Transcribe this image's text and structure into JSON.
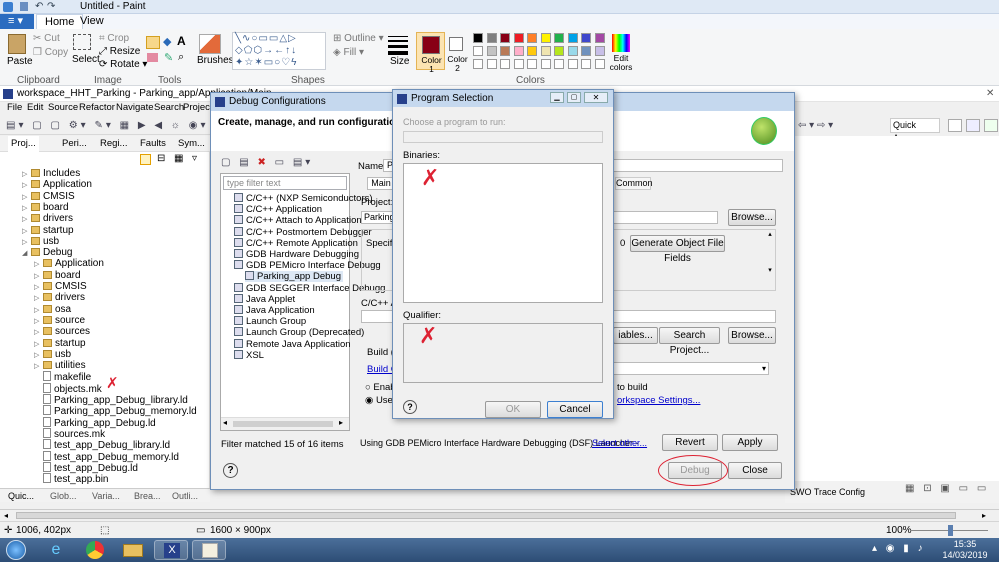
{
  "paint": {
    "title": "Untitled - Paint",
    "tabs": [
      "Home",
      "View"
    ],
    "groups": [
      "Clipboard",
      "Image",
      "Tools",
      "Shapes",
      "Colors"
    ],
    "clipboard": {
      "paste": "Paste",
      "cut": "Cut",
      "copy": "Copy"
    },
    "image": {
      "select": "Select",
      "crop": "Crop",
      "resize": "Resize",
      "rotate": "Rotate"
    },
    "brushes": "Brushes",
    "outline": "Outline",
    "fill": "Fill",
    "size": "Size",
    "color1": "Color 1",
    "color2": "Color 2",
    "edit_colors": "Edit colors",
    "palette": [
      "#000000",
      "#7f7f7f",
      "#880015",
      "#ed1c24",
      "#ff7f27",
      "#fff200",
      "#22b14c",
      "#00a2e8",
      "#3f48cc",
      "#a349a4",
      "#ffffff",
      "#c3c3c3",
      "#b97a57",
      "#ffaec9",
      "#ffc90e",
      "#efe4b0",
      "#b5e61d",
      "#99d9ea",
      "#7092be",
      "#c8bfe7"
    ],
    "status_pos": "1006, 402px",
    "status_size": "1600 × 900px",
    "zoom": "100%"
  },
  "eclipse": {
    "title": "workspace_HHT_Parking - Parking_app/Application/Main_",
    "menu": [
      "File",
      "Edit",
      "Source",
      "Refactor",
      "Navigate",
      "Search",
      "Project"
    ],
    "view_tabs": [
      "Proj...",
      "Peri...",
      "Regi...",
      "Faults",
      "Sym..."
    ],
    "tree": [
      {
        "label": "Includes",
        "type": "folder",
        "indent": 0
      },
      {
        "label": "Application",
        "type": "folder",
        "indent": 0
      },
      {
        "label": "CMSIS",
        "type": "folder",
        "indent": 0
      },
      {
        "label": "board",
        "type": "folder",
        "indent": 0
      },
      {
        "label": "drivers",
        "type": "folder",
        "indent": 0
      },
      {
        "label": "startup",
        "type": "folder",
        "indent": 0
      },
      {
        "label": "usb",
        "type": "folder",
        "indent": 0
      },
      {
        "label": "Debug",
        "type": "folder",
        "indent": 0
      },
      {
        "label": "Application",
        "type": "folder",
        "indent": 1
      },
      {
        "label": "board",
        "type": "folder",
        "indent": 1
      },
      {
        "label": "CMSIS",
        "type": "folder",
        "indent": 1
      },
      {
        "label": "drivers",
        "type": "folder",
        "indent": 1
      },
      {
        "label": "osa",
        "type": "folder",
        "indent": 1
      },
      {
        "label": "source",
        "type": "folder",
        "indent": 1
      },
      {
        "label": "sources",
        "type": "folder",
        "indent": 1
      },
      {
        "label": "startup",
        "type": "folder",
        "indent": 1
      },
      {
        "label": "usb",
        "type": "folder",
        "indent": 1
      },
      {
        "label": "utilities",
        "type": "folder",
        "indent": 1
      },
      {
        "label": "makefile",
        "type": "file",
        "indent": 1
      },
      {
        "label": "objects.mk",
        "type": "file",
        "indent": 1
      },
      {
        "label": "Parking_app_Debug_library.ld",
        "type": "file",
        "indent": 1
      },
      {
        "label": "Parking_app_Debug_memory.ld",
        "type": "file",
        "indent": 1
      },
      {
        "label": "Parking_app_Debug.ld",
        "type": "file",
        "indent": 1
      },
      {
        "label": "sources.mk",
        "type": "file",
        "indent": 1
      },
      {
        "label": "test_app_Debug_library.ld",
        "type": "file",
        "indent": 1
      },
      {
        "label": "test_app_Debug_memory.ld",
        "type": "file",
        "indent": 1
      },
      {
        "label": "test_app_Debug.ld",
        "type": "file",
        "indent": 1
      },
      {
        "label": "test_app.bin",
        "type": "file",
        "indent": 1
      }
    ],
    "bottom_tabs": [
      "Quic...",
      "Glob...",
      "Varia...",
      "Brea...",
      "Outli..."
    ],
    "quick_access": "Quick Access",
    "trace_config": "SWO Trace Config"
  },
  "debug_config": {
    "title": "Debug Configurations",
    "heading": "Create, manage, and run configurations",
    "filter_placeholder": "type filter text",
    "items": [
      {
        "label": "C/C++ (NXP Semiconductors)",
        "indent": 0
      },
      {
        "label": "C/C++ Application",
        "indent": 0
      },
      {
        "label": "C/C++ Attach to Application",
        "indent": 0
      },
      {
        "label": "C/C++ Postmortem Debugger",
        "indent": 0
      },
      {
        "label": "C/C++ Remote Application",
        "indent": 0
      },
      {
        "label": "GDB Hardware Debugging",
        "indent": 0
      },
      {
        "label": "GDB PEMicro Interface Debugg",
        "indent": 0
      },
      {
        "label": "Parking_app Debug",
        "indent": 1
      },
      {
        "label": "GDB SEGGER Interface Debugg",
        "indent": 0
      },
      {
        "label": "Java Applet",
        "indent": 0
      },
      {
        "label": "Java Application",
        "indent": 0
      },
      {
        "label": "Launch Group",
        "indent": 0
      },
      {
        "label": "Launch Group (Deprecated)",
        "indent": 0
      },
      {
        "label": "Remote Java Application",
        "indent": 0
      },
      {
        "label": "XSL",
        "indent": 0
      }
    ],
    "filter_status": "Filter matched 15 of 16 items",
    "name_label": "Name:",
    "name_value": "P",
    "tab_main": "Main",
    "tab_common": "Common",
    "project_label": "Project:",
    "project_value": "Parking",
    "specify": "Specify",
    "object_value": "0",
    "generate_fields": "Generate Object File Fields",
    "cpp_label": "C/C++ A",
    "build_label": "Build (i",
    "build_link": "Build C",
    "enable_label": "Enab",
    "use_label": "Use",
    "to_build": "to build",
    "workspace_link": "orkspace Settings...",
    "variables_btn": "iables...",
    "search_project": "Search Project...",
    "browse": "Browse...",
    "launcher_text": "Using GDB PEMicro Interface Hardware Debugging (DSF) Launcher -",
    "select_other": "Select other...",
    "revert": "Revert",
    "apply": "Apply",
    "debug": "Debug",
    "close": "Close"
  },
  "program_selection": {
    "title": "Program Selection",
    "prompt": "Choose a program to run:",
    "binaries": "Binaries:",
    "qualifier": "Qualifier:",
    "ok": "OK",
    "cancel": "Cancel"
  },
  "taskbar": {
    "time": "15:35",
    "date": "14/03/2019"
  }
}
